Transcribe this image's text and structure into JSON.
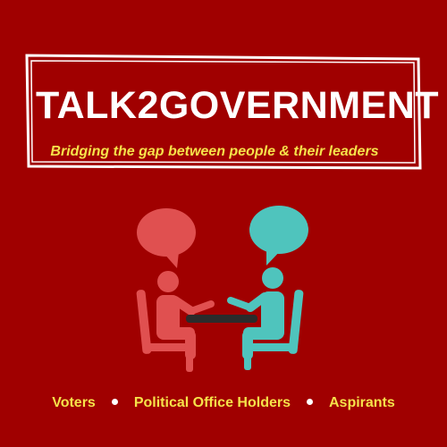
{
  "header": {
    "title": "TALK2GOVERNMENT",
    "tagline": "Bridging the gap between people & their leaders"
  },
  "footer": {
    "items": [
      "Voters",
      "Political Office Holders",
      "Aspirants"
    ]
  },
  "illustration": {
    "left_person_icon": "person-talking-icon",
    "right_person_icon": "person-listening-icon",
    "left_bubble_icon": "speech-bubble-icon",
    "right_bubble_icon": "speech-bubble-icon",
    "colors": {
      "background": "#a00000",
      "left_figure": "#e05050",
      "right_figure": "#4fc4bd",
      "table": "#2b2b2b",
      "title_text": "#ffffff",
      "accent_text": "#f5e24a"
    }
  }
}
